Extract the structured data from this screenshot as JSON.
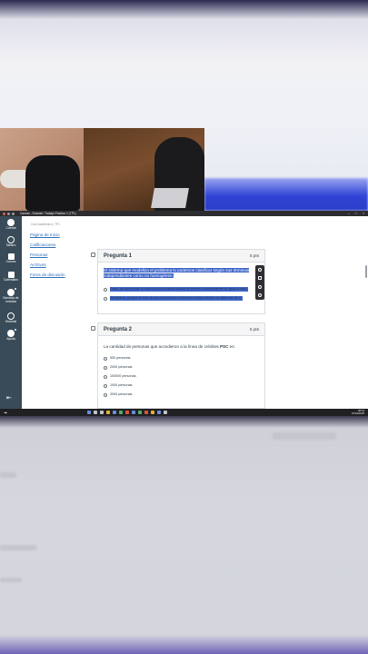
{
  "window": {
    "title": "Canvas - Examen: Trabajo Práctico 1 (TP1)"
  },
  "nav": {
    "items": [
      {
        "label": "Cuenta",
        "icon": "account-icon"
      },
      {
        "label": "Tablero",
        "icon": "dashboard-icon"
      },
      {
        "label": "Cursos",
        "icon": "courses-icon"
      },
      {
        "label": "Calendario",
        "icon": "calendar-icon"
      },
      {
        "label": "Bandeja de entrada",
        "icon": "inbox-icon"
      },
      {
        "label": "Historial",
        "icon": "history-icon"
      },
      {
        "label": "Ayuda",
        "icon": "help-icon"
      }
    ]
  },
  "breadcrumb": "Ciclo Académico | TP1",
  "course_nav": {
    "links": [
      "Página de Inicio",
      "Calificaciones",
      "Personas",
      "Archivos",
      "Foros de discusión"
    ]
  },
  "questions": [
    {
      "title": "Pregunta 1",
      "points": "5 pts",
      "text": "El sistema que modeliza el problema lo podemos clasificar según sus términos independientes como no homogéneo.",
      "options": [
        "Falso, ya que posee al menos una ecuación donde el término independiente es igual a cero",
        "Verdadero, ya que en uno de sus ecuaciones el término independiente es diferente de 0"
      ]
    },
    {
      "title": "Pregunta 2",
      "points": "5 pts",
      "text_before": "La cantidad de personas que accedieron a la línea de créditos ",
      "text_strong": "PSC",
      "text_after": " es:",
      "options": [
        "500 personas.",
        "2000 personas.",
        "100000 personas.",
        "1000 personas.",
        "3000 personas."
      ]
    }
  ],
  "taskbar": {
    "weather": "☁",
    "time": "08:31",
    "date": "15/03/2025"
  },
  "colors": {
    "nav_bg": "#394b58",
    "link": "#2d6fb6",
    "selection": "#3b63c8"
  }
}
